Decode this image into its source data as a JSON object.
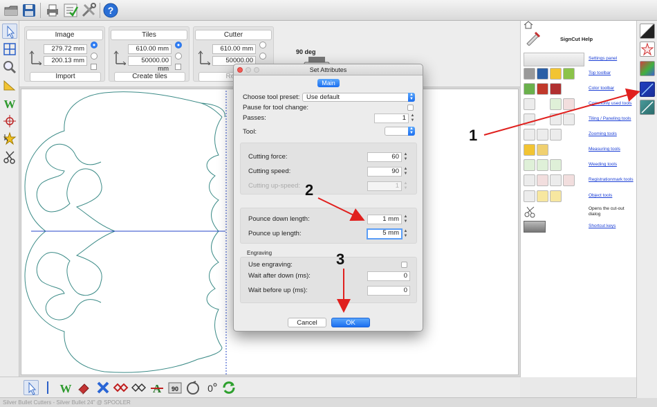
{
  "settings_panel": {
    "image": {
      "title": "Image",
      "width": "279.72 mm",
      "height": "200.13 mm",
      "button": "Import"
    },
    "tiles": {
      "title": "Tiles",
      "width": "610.00 mm",
      "height": "50000.00 mm",
      "button": "Create tiles"
    },
    "cutter": {
      "title": "Cutter",
      "width": "610.00 mm",
      "height": "50000.00 mm",
      "button": "Read"
    },
    "rotation": "90 deg"
  },
  "dialog": {
    "title": "Set Attributes",
    "tab": "Main",
    "tool_preset_label": "Choose tool preset:",
    "tool_preset_value": "Use default",
    "pause_label": "Pause for tool change:",
    "passes_label": "Passes:",
    "passes_value": "1",
    "tool_label": "Tool:",
    "tool_value": "",
    "cutting_force_label": "Cutting force:",
    "cutting_force_value": "60",
    "cutting_speed_label": "Cutting speed:",
    "cutting_speed_value": "90",
    "cutting_upspeed_label": "Cutting up-speed:",
    "cutting_upspeed_value": "1",
    "pounce_down_label": "Pounce down length:",
    "pounce_down_value": "1 mm",
    "pounce_up_label": "Pounce up length:",
    "pounce_up_value": "5 mm",
    "engraving_header": "Engraving",
    "use_engraving_label": "Use engraving:",
    "wait_after_down_label": "Wait after down (ms):",
    "wait_after_down_value": "0",
    "wait_before_up_label": "Wait before up (ms):",
    "wait_before_up_value": "0",
    "cancel": "Cancel",
    "ok": "OK"
  },
  "help": {
    "title": "SignCut Help",
    "items": [
      {
        "label": "Settings panel"
      },
      {
        "label": "Top toolbar"
      },
      {
        "label": "Color toolbar"
      },
      {
        "label": "Commonly used tools"
      },
      {
        "label": "Tiling / Paneling tools"
      },
      {
        "label": "Zooming tools"
      },
      {
        "label": "Measuring tools"
      },
      {
        "label": "Weeding tools"
      },
      {
        "label": "Registrationmark tools"
      },
      {
        "label": "Object tools"
      },
      {
        "label": "Opens the cut-out dialog"
      },
      {
        "label": "Shortcut keys"
      }
    ]
  },
  "callouts": [
    "1",
    "2",
    "3"
  ],
  "status": "Silver Bullet Cutters - Silver Bullet 24\" @ SPOOLER",
  "colors": {
    "accent": "#2c74e2",
    "arrow": "#e0201e",
    "outline": "#3a8a86",
    "guide": "#2446c8"
  }
}
